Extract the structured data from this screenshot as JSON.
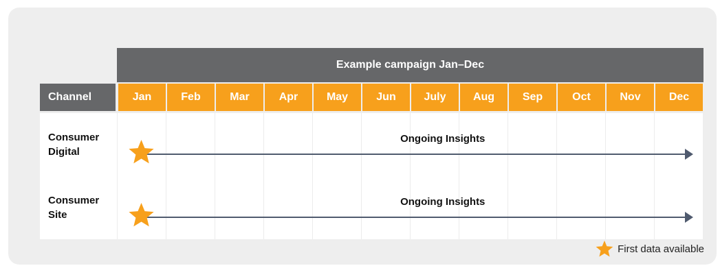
{
  "campaign_title": "Example campaign Jan–Dec",
  "channel_header": "Channel",
  "months": [
    "Jan",
    "Feb",
    "Mar",
    "Apr",
    "May",
    "Jun",
    "July",
    "Aug",
    "Sep",
    "Oct",
    "Nov",
    "Dec"
  ],
  "rows": [
    {
      "channel": "Consumer\nDigital",
      "bar_label": "Ongoing Insights",
      "start_month": "Jan",
      "end_month": "Dec"
    },
    {
      "channel": "Consumer\nSite",
      "bar_label": "Ongoing Insights",
      "start_month": "Jan",
      "end_month": "Dec"
    }
  ],
  "legend": {
    "icon": "star-icon",
    "label": "First data available"
  },
  "colors": {
    "header_gray": "#666769",
    "month_orange": "#f7a01c",
    "star": "#f7a01c",
    "arrow": "#4f5a6e",
    "panel": "#eeeeee"
  }
}
